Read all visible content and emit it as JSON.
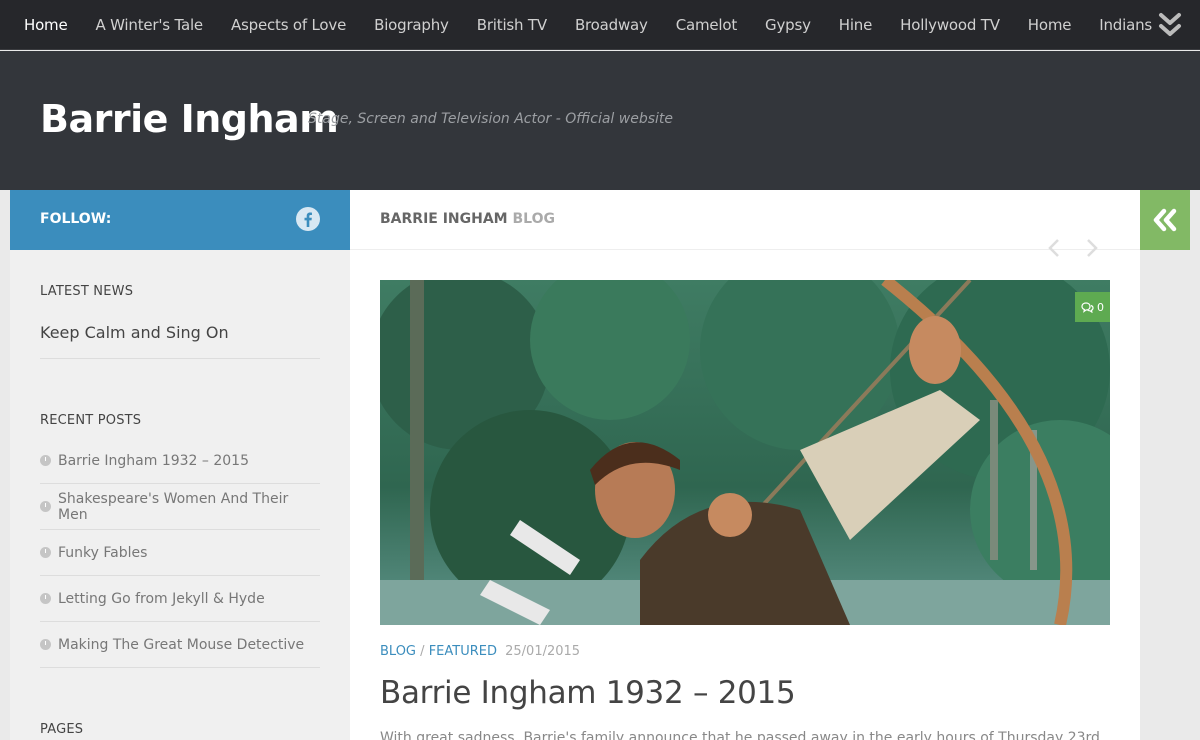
{
  "nav": {
    "items": [
      {
        "label": "Home"
      },
      {
        "label": "A Winter's Tale"
      },
      {
        "label": "Aspects of Love"
      },
      {
        "label": "Biography"
      },
      {
        "label": "British TV"
      },
      {
        "label": "Broadway"
      },
      {
        "label": "Camelot"
      },
      {
        "label": "Gypsy"
      },
      {
        "label": "Hine"
      },
      {
        "label": "Hollywood TV"
      },
      {
        "label": "Home"
      },
      {
        "label": "Indians"
      }
    ],
    "toggle_icon": "double-chevron-down-icon"
  },
  "header": {
    "title": "Barrie Ingham",
    "description": "Stage, Screen and Television Actor - Official website"
  },
  "sidebar": {
    "follow_label": "FOLLOW:",
    "follow_icon": "facebook-icon",
    "latest_news_title": "LATEST NEWS",
    "latest_news_link": "Keep Calm and Sing On",
    "recent_posts_title": "RECENT POSTS",
    "recent_posts": [
      {
        "label": "Barrie Ingham 1932 – 2015"
      },
      {
        "label": "Shakespeare's Women And Their Men"
      },
      {
        "label": "Funky Fables"
      },
      {
        "label": "Letting Go from Jekyll & Hyde"
      },
      {
        "label": "Making The Great Mouse Detective"
      }
    ],
    "pages_title": "PAGES"
  },
  "main": {
    "heading_bold": "BARRIE INGHAM",
    "heading_sub": "BLOG",
    "post": {
      "comment_count": "0",
      "category_1": "BLOG",
      "separator": "/",
      "category_2": "FEATURED",
      "date": "25/01/2015",
      "title": "Barrie Ingham 1932 – 2015",
      "excerpt": "With great sadness, Barrie's family announce that he passed away in the early hours of Thursday 23rd"
    }
  },
  "colors": {
    "topnav_bg": "#26272b",
    "header_bg": "#33363b",
    "follow_blue": "#3b8dbd",
    "toggle_green": "#82b965",
    "badge_green": "#5eaa51"
  }
}
